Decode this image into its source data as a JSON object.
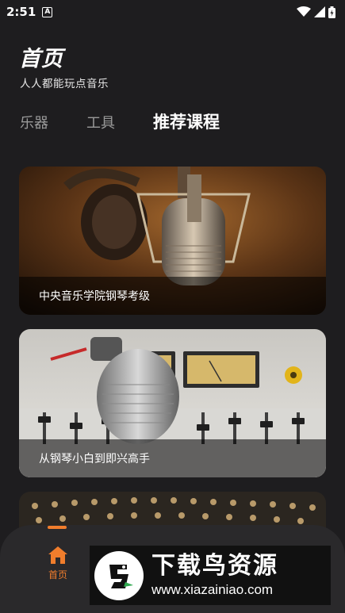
{
  "status_bar": {
    "time": "2:51",
    "icons": [
      "notification-a-icon",
      "wifi-icon",
      "signal-icon",
      "battery-icon"
    ]
  },
  "header": {
    "title": "首页",
    "subtitle": "人人都能玩点音乐"
  },
  "tabs": [
    {
      "label": "乐器",
      "active": false
    },
    {
      "label": "工具",
      "active": false
    },
    {
      "label": "推荐课程",
      "active": true
    }
  ],
  "courses": [
    {
      "title": "中央音乐学院钢琴考级"
    },
    {
      "title": "从钢琴小白到即兴高手"
    },
    {
      "title": ""
    }
  ],
  "bottom_nav": {
    "home_label": "首页",
    "accent": "#f07d2c"
  },
  "watermark": {
    "title": "下载鸟资源",
    "url": "www.xiazainiao.com"
  }
}
